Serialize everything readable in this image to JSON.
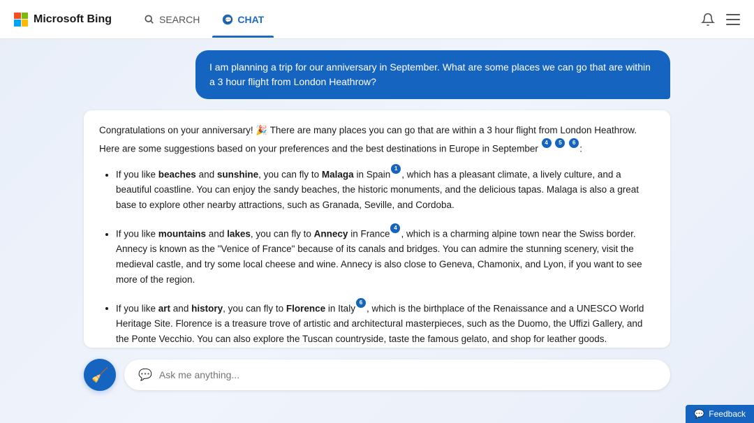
{
  "header": {
    "logo_text": "Microsoft Bing",
    "nav": {
      "search_label": "SEARCH",
      "chat_label": "CHAT"
    }
  },
  "user_message": "I am planning a trip for our anniversary in September. What are some places we can go that are within a 3 hour flight from London Heathrow?",
  "ai_response": {
    "intro": "Congratulations on your anniversary! 🎉 There are many places you can go that are within a 3 hour flight from London Heathrow. Here are some suggestions based on your preferences and the best destinations in Europe in September",
    "intro_refs": [
      "4",
      "5",
      "6"
    ],
    "items": [
      {
        "text_parts": [
          {
            "text": "If you like ",
            "bold": false
          },
          {
            "text": "beaches",
            "bold": true
          },
          {
            "text": " and ",
            "bold": false
          },
          {
            "text": "sunshine",
            "bold": true
          },
          {
            "text": ", you can fly to ",
            "bold": false
          },
          {
            "text": "Malaga",
            "bold": true
          },
          {
            "text": " in Spain",
            "bold": false
          }
        ],
        "ref": "1",
        "rest": ", which has a pleasant climate, a lively culture, and a beautiful coastline. You can enjoy the sandy beaches, the historic monuments, and the delicious tapas. Malaga is also a great base to explore other nearby attractions, such as Granada, Seville, and Cordoba."
      },
      {
        "text_parts": [
          {
            "text": "If you like ",
            "bold": false
          },
          {
            "text": "mountains",
            "bold": true
          },
          {
            "text": " and ",
            "bold": false
          },
          {
            "text": "lakes",
            "bold": true
          },
          {
            "text": ", you can fly to ",
            "bold": false
          },
          {
            "text": "Annecy",
            "bold": true
          },
          {
            "text": " in France",
            "bold": false
          }
        ],
        "ref": "4",
        "rest": ", which is a charming alpine town near the Swiss border. Annecy is known as the \"Venice of France\" because of its canals and bridges. You can admire the stunning scenery, visit the medieval castle, and try some local cheese and wine. Annecy is also close to Geneva, Chamonix, and Lyon, if you want to see more of the region."
      },
      {
        "text_parts": [
          {
            "text": "If you like ",
            "bold": false
          },
          {
            "text": "art",
            "bold": true
          },
          {
            "text": " and ",
            "bold": false
          },
          {
            "text": "history",
            "bold": true
          },
          {
            "text": ", you can fly to ",
            "bold": false
          },
          {
            "text": "Florence",
            "bold": true
          },
          {
            "text": " in Italy",
            "bold": false
          }
        ],
        "ref": "6",
        "rest": ", which is the birthplace of the Renaissance and a UNESCO World Heritage Site. Florence is a treasure trove of artistic and architectural masterpieces, such as the Duomo, the Uffizi Gallery, and the Ponte Vecchio. You can also explore the Tuscan countryside, taste the famous gelato, and shop for leather goods."
      }
    ]
  },
  "input": {
    "placeholder": "Ask me anything..."
  },
  "feedback": {
    "label": "Feedback"
  }
}
